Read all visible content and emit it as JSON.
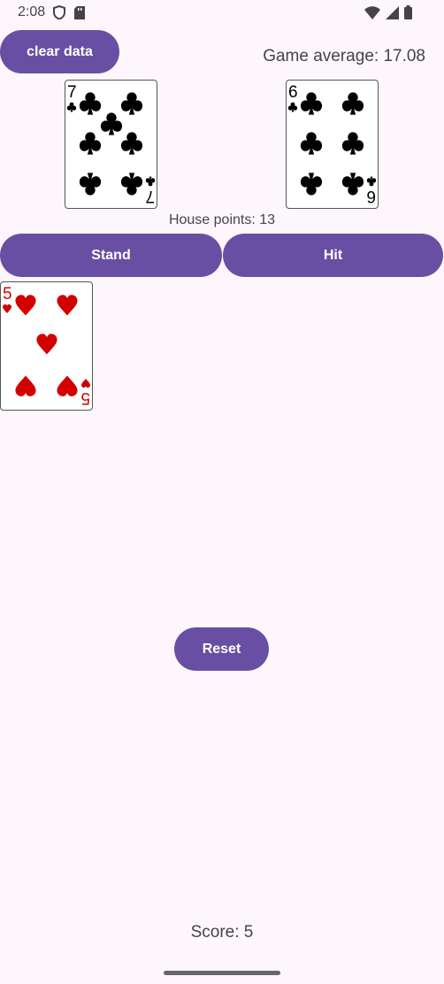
{
  "status_bar": {
    "time": "2:08",
    "icons": [
      "shield-icon",
      "sd-card-icon",
      "wifi-icon",
      "signal-icon",
      "battery-icon"
    ]
  },
  "buttons": {
    "clear_data": "clear data",
    "stand": "Stand",
    "hit": "Hit",
    "reset": "Reset"
  },
  "game_average": "Game average: 17.08",
  "house_points": "House points: 13",
  "score": "Score: 5",
  "house_cards": [
    {
      "rank": "7",
      "suit": "clubs",
      "color": "#000000"
    },
    {
      "rank": "6",
      "suit": "clubs",
      "color": "#000000"
    }
  ],
  "player_cards": [
    {
      "rank": "5",
      "suit": "hearts",
      "color": "#d40000"
    }
  ],
  "colors": {
    "accent": "#684fa3",
    "background": "#fdf7fd"
  }
}
